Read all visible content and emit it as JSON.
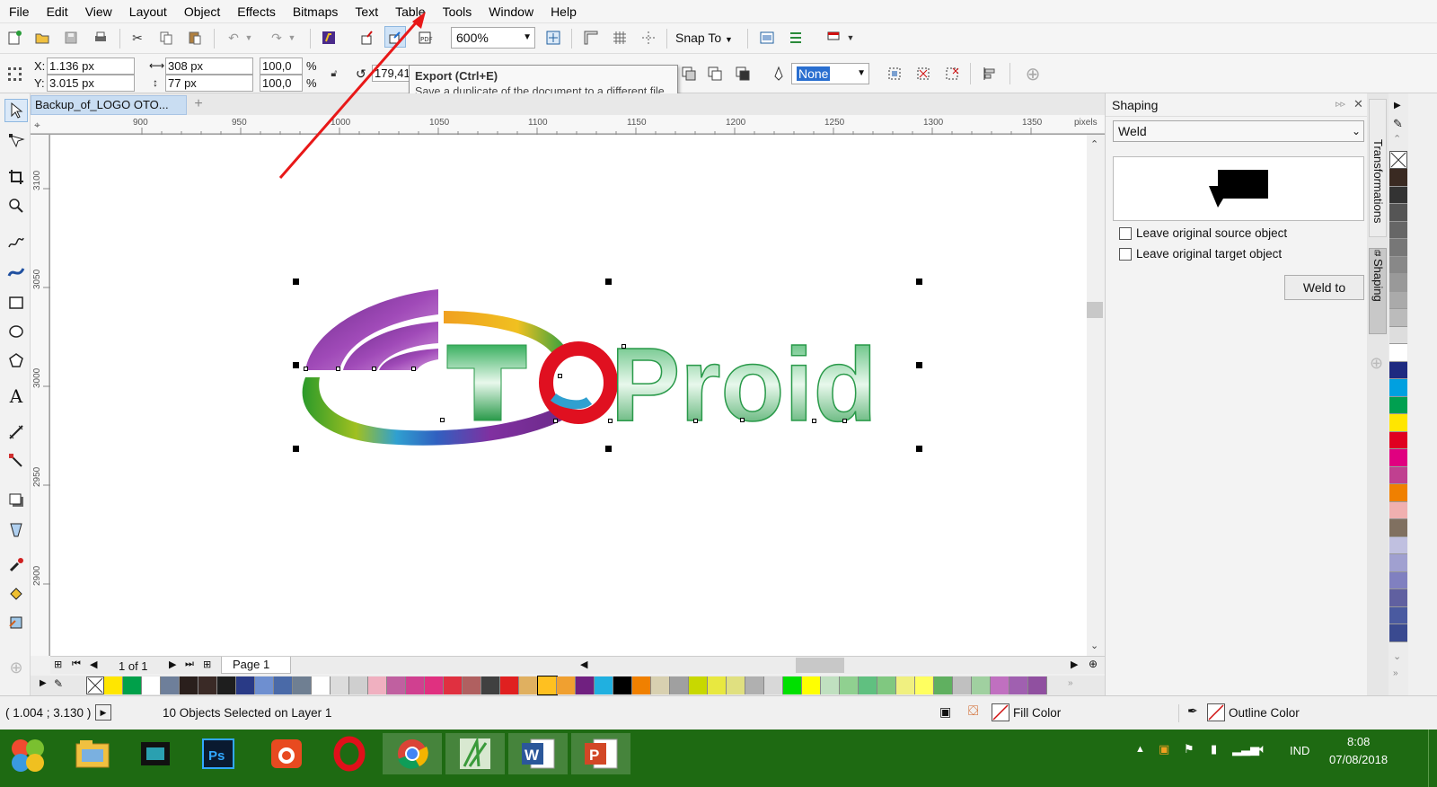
{
  "menu": [
    "File",
    "Edit",
    "View",
    "Layout",
    "Object",
    "Effects",
    "Bitmaps",
    "Text",
    "Table",
    "Tools",
    "Window",
    "Help"
  ],
  "std_toolbar": {
    "zoom_level": "600%",
    "snap_to_label": "Snap To"
  },
  "property_bar": {
    "x_label": "X:",
    "x_value": "1.136 px",
    "y_label": "Y:",
    "y_value": "3.015 px",
    "width_value": "308 px",
    "height_value": "77 px",
    "scale_x": "100,0",
    "scale_y": "100,0",
    "percent": "%",
    "rotation": "179,41",
    "outline_width": "None"
  },
  "tooltip": {
    "title": "Export (Ctrl+E)",
    "body": "Save a duplicate of the document to a different file format."
  },
  "document": {
    "tab_title": "Backup_of_LOGO OTO...",
    "ruler_unit": "pixels",
    "h_ticks": [
      "900",
      "950",
      "1000",
      "1050",
      "1100",
      "1150",
      "1200",
      "1250",
      "1300",
      "1350"
    ],
    "v_ticks": [
      "3100",
      "3050",
      "3000",
      "2950",
      "2900"
    ],
    "logo_text_1": "TO",
    "logo_text_2": "Proid",
    "page_count": "1 of 1",
    "page_tab": "Page 1"
  },
  "docker": {
    "title": "Shaping",
    "mode": "Weld",
    "checkbox1": "Leave original source object",
    "checkbox2": "Leave original target object",
    "button": "Weld to",
    "side_tabs": [
      "Transformations",
      "Shaping"
    ]
  },
  "status": {
    "coords": "( 1.004 ; 3.130 )",
    "selection": "10 Objects Selected on Layer 1",
    "fill_label": "Fill Color",
    "outline_label": "Outline Color"
  },
  "taskbar": {
    "language": "IND",
    "time": "8:08",
    "date": "07/08/2018"
  },
  "colors": {
    "doc_palette": [
      "#ffe600",
      "#00a04a",
      "#ffffff",
      "#6e7f9a",
      "#2a1f1c",
      "#3a2a26",
      "#1e1e1e",
      "#293a86",
      "#6e8fd0",
      "#4a6aa8",
      "#6f7f92",
      "#ffffff",
      "#dcdcdc",
      "#cfcfcf",
      "#f0b0c0",
      "#c060a0",
      "#d04090",
      "#e03080",
      "#e03040",
      "#b06060",
      "#404040",
      "#e02020",
      "#e0b060",
      "#ffc020",
      "#f0a030",
      "#702080",
      "#20b0e0",
      "#000000",
      "#f08000",
      "#d8d0b0",
      "#a0a0a0",
      "#c8d800",
      "#e8e840",
      "#e0e080",
      "#b0b0b0",
      "#d8d8d8",
      "#00e000",
      "#ffff00",
      "#c0e0c0",
      "#90d090",
      "#60c080",
      "#80c880",
      "#f0f080",
      "#ffff60",
      "#60b060",
      "#c0c0c0",
      "#a0d0a0",
      "#c070c0",
      "#a060b0",
      "#9050a0"
    ],
    "side_palette": [
      "#3a2a22",
      "#333333",
      "#555555",
      "#666666",
      "#777777",
      "#888888",
      "#999999",
      "#aaaaaa",
      "#bbbbbb",
      "#dddddd",
      "#ffffff",
      "#1e2a80",
      "#00a0e0",
      "#00a050",
      "#ffe600",
      "#e00020",
      "#e00080",
      "#c04090",
      "#f08000",
      "#f0b0b0",
      "#807060",
      "#c0c0e0",
      "#a0a0d0",
      "#8080c0",
      "#6060a0",
      "#4a5aa0",
      "#3a4a90"
    ]
  }
}
